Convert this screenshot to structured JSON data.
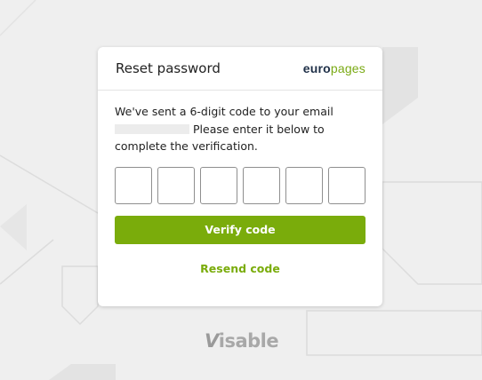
{
  "dialog": {
    "title": "Reset password",
    "logo": {
      "part1": "euro",
      "part2": "pages"
    },
    "message_line1": "We've sent a 6-digit code to your email",
    "message_line2": "Please enter it below to complete the verification.",
    "code_length": 6,
    "verify_button": "Verify code",
    "resend_link": "Resend code"
  },
  "footer_brand": {
    "mark": "V",
    "text": "isable"
  },
  "colors": {
    "accent": "#7aac0b",
    "logo_dark": "#1f3048",
    "background": "#efefef"
  }
}
